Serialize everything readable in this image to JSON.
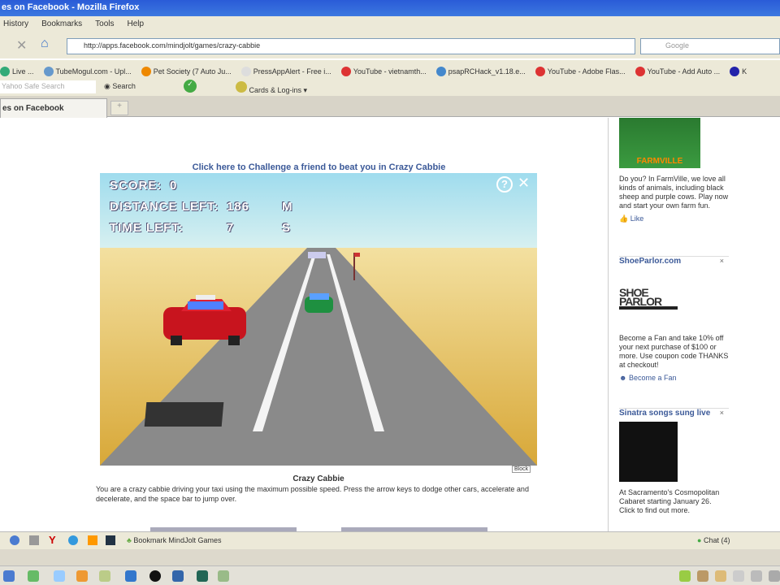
{
  "window": {
    "title": "es on Facebook - Mozilla Firefox"
  },
  "menu": [
    "History",
    "Bookmarks",
    "Tools",
    "Help"
  ],
  "nav": {
    "url": "http://apps.facebook.com/mindjolt/games/crazy-cabbie",
    "search_placeholder": "Google"
  },
  "bookmarks": [
    {
      "label": "Live ...",
      "color": "#3a7"
    },
    {
      "label": "TubeMogul.com - Upl...",
      "color": "#69c"
    },
    {
      "label": "Pet Society (7 Auto Ju...",
      "color": "#e80"
    },
    {
      "label": "PressAppAlert - Free i...",
      "color": "#ddd"
    },
    {
      "label": "YouTube - vietnamth...",
      "color": "#d33"
    },
    {
      "label": "psapRCHack_v1.18.e...",
      "color": "#48c"
    },
    {
      "label": "YouTube - Adobe Flas...",
      "color": "#d33"
    },
    {
      "label": "YouTube - Add Auto ...",
      "color": "#d33"
    },
    {
      "label": "K",
      "color": "#22a"
    }
  ],
  "toolbar2": {
    "safe_search": "Yahoo Safe Search",
    "search_btn": "Search",
    "cards": "Cards & Log-ins"
  },
  "tab": {
    "label": "es on Facebook",
    "new": "+"
  },
  "page": {
    "challenge": "Click here to Challenge a friend to beat you in Crazy Cabbie",
    "hud": {
      "score_label": "SCORE:",
      "score": "0",
      "distance_label": "DISTANCE LEFT:",
      "distance": "186",
      "distance_unit": "M",
      "time_label": "TIME LEFT:",
      "time": "7",
      "time_unit": "S"
    },
    "game_help": "?",
    "block_label": "Block",
    "game_title": "Crazy Cabbie",
    "description": "You are a crazy cabbie driving your taxi using the maximum possible speed. Press the arrow keys to dodge other cars, accelerate and decelerate, and the space bar to jump over."
  },
  "ads": [
    {
      "logo": "FarmVille",
      "text": "Do you? In FarmVille, we love all kinds of animals, including black sheep and purple cows. Play now and start your own farm fun.",
      "action": "Like"
    },
    {
      "title": "ShoeParlor.com",
      "logo": "SHOE PARLOR",
      "text": "Become a Fan and take 10% off your next purchase of $100 or more. Use coupon code THANKS at checkout!",
      "action": "Become a Fan"
    },
    {
      "title": "Sinatra songs sung live",
      "text": "At Sacramento's Cosmopolitan Cabaret starting January 26. Click to find out more."
    }
  ],
  "statusbar": {
    "bookmark": "Bookmark MindJolt Games",
    "chat": "Chat (4)"
  }
}
